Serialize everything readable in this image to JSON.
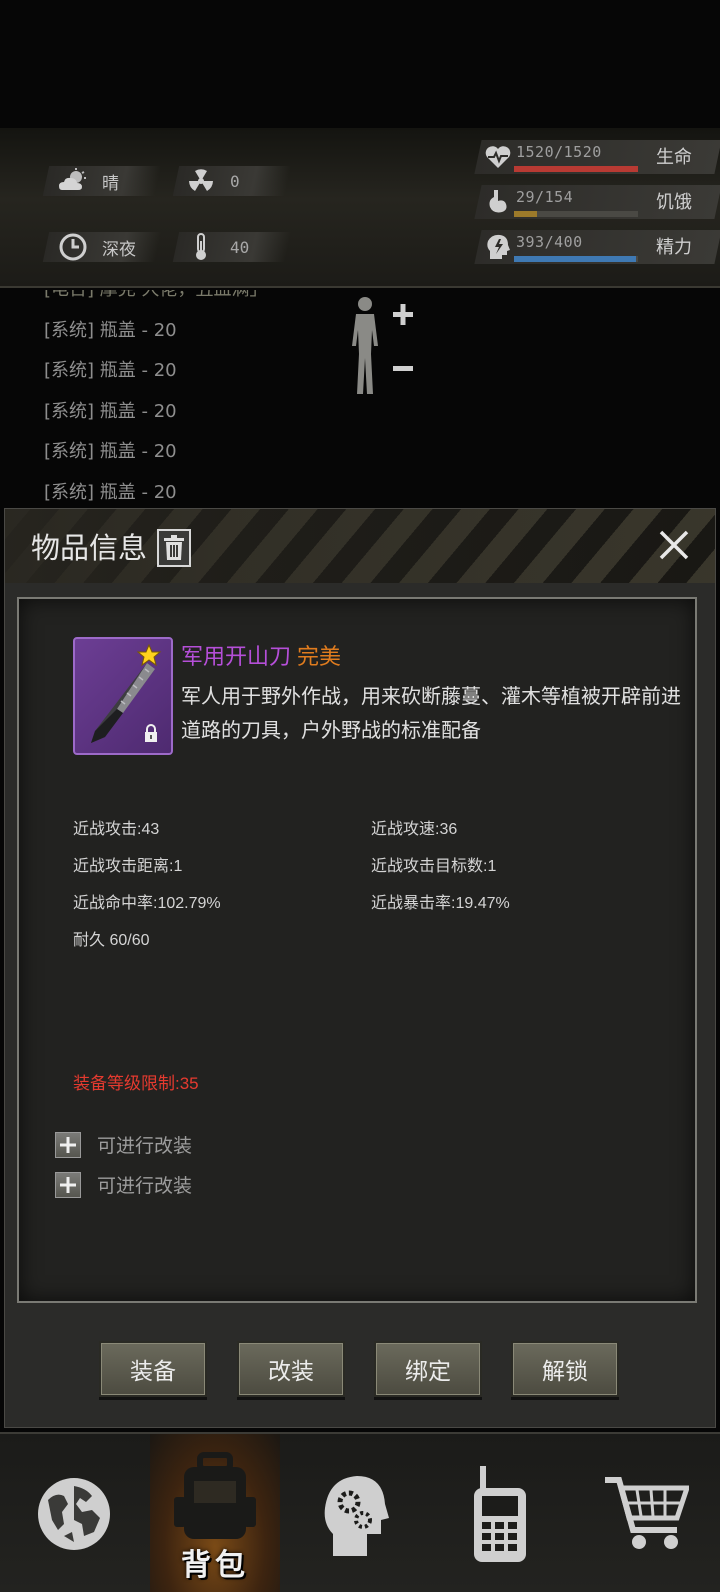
{
  "status": {
    "weather": {
      "icon": "cloud-sun-icon",
      "label": "晴"
    },
    "radiation": {
      "icon": "radiation-icon",
      "value": "0"
    },
    "time": {
      "icon": "clock-icon",
      "label": "深夜"
    },
    "temperature": {
      "icon": "thermometer-icon",
      "value": "40"
    },
    "stats": [
      {
        "name": "生命",
        "icon": "heart-pulse-icon",
        "text": "1520/1520",
        "fraction": 1.0,
        "color": "#b83a33"
      },
      {
        "name": "饥饿",
        "icon": "stomach-icon",
        "text": "29/154",
        "fraction": 0.188,
        "color": "#9c7a2a"
      },
      {
        "name": "精力",
        "icon": "energy-head-icon",
        "text": "393/400",
        "fraction": 0.98,
        "color": "#3f79b3"
      }
    ]
  },
  "log": [
    "[电台] 摩克·大佬，丑血满」",
    "[系统] 瓶盖 - 20",
    "[系统] 瓶盖 - 20",
    "[系统] 瓶盖 - 20",
    "[系统] 瓶盖 - 20",
    "[系统] 瓶盖 - 20"
  ],
  "modal": {
    "title": "物品信息",
    "item": {
      "name": "军用开山刀",
      "quality": "完美",
      "description": "军人用于野外作战，用来砍断藤蔓、灌木等植被开辟前进道路的刀具，户外野战的标准配备"
    },
    "attributes": {
      "melee_attack": "近战攻击:43",
      "melee_speed": "近战攻速:36",
      "melee_range": "近战攻击距离:1",
      "melee_targets": "近战攻击目标数:1",
      "melee_hit": "近战命中率:102.79%",
      "melee_crit": "近战暴击率:19.47%",
      "durability": "耐久 60/60"
    },
    "level_limit": "装备等级限制:35",
    "mod_slots": [
      "可进行改装",
      "可进行改装"
    ],
    "buttons": {
      "equip": "装备",
      "modify": "改装",
      "bind": "绑定",
      "unlock": "解锁"
    }
  },
  "nav": {
    "map": "map-globe-icon",
    "backpack": "背包",
    "skills": "head-gears-icon",
    "radio": "walkie-talkie-icon",
    "shop": "shopping-cart-icon"
  }
}
